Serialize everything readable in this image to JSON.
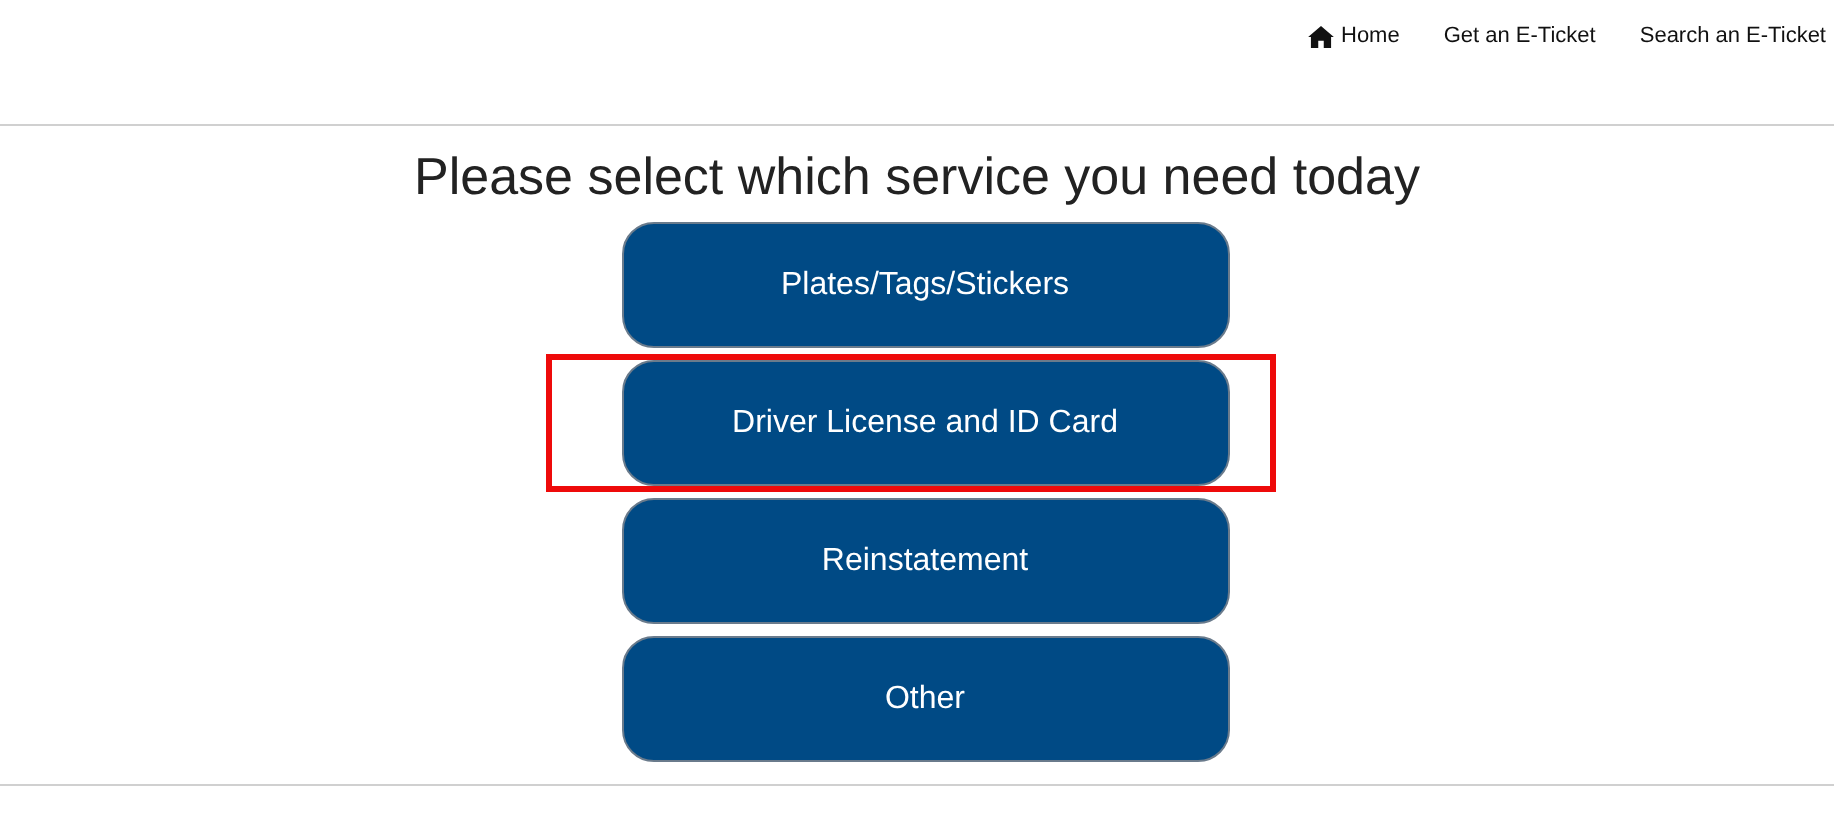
{
  "nav": [
    {
      "label": "Home",
      "kind": "home"
    },
    {
      "label": "Get an E-Ticket",
      "kind": "link"
    },
    {
      "label": "Search an E-Ticket",
      "kind": "link"
    }
  ],
  "heading": "Please select which service you need today",
  "services": [
    {
      "label": "Plates/Tags/Stickers",
      "highlighted": false
    },
    {
      "label": "Driver License and ID Card",
      "highlighted": true
    },
    {
      "label": "Reinstatement",
      "highlighted": false
    },
    {
      "label": "Other",
      "highlighted": false
    }
  ]
}
